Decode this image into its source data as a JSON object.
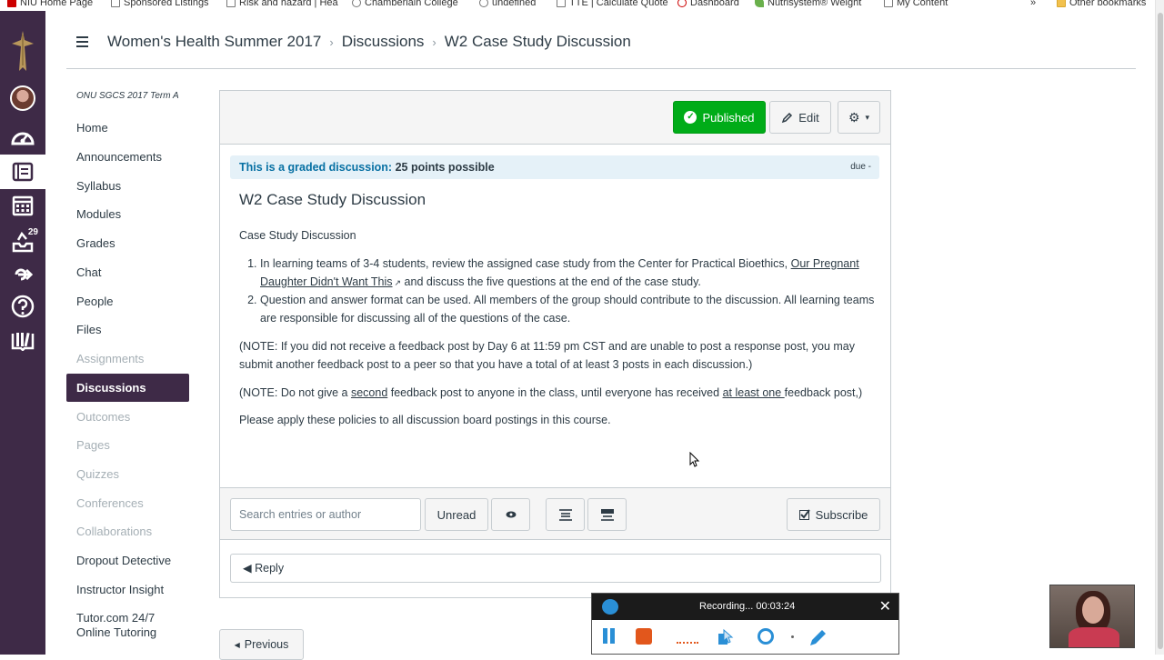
{
  "bookmarks": [
    {
      "label": "NIU Home Page",
      "icon": "niu-icon"
    },
    {
      "label": "Sponsored Listings",
      "icon": "page-icon"
    },
    {
      "label": "Risk and hazard | Hea",
      "icon": "page-icon"
    },
    {
      "label": "Chamberlain College",
      "icon": "shield-icon"
    },
    {
      "label": "undefined",
      "icon": "spiral-icon"
    },
    {
      "label": "TTE | Calculate Quote",
      "icon": "page-icon"
    },
    {
      "label": "Dashboard",
      "icon": "eye-icon"
    },
    {
      "label": "Nutrisystem® Weight",
      "icon": "leaf-icon"
    },
    {
      "label": "My Content",
      "icon": "page-icon"
    }
  ],
  "bookmarks_more": "»",
  "other_bookmarks": "Other bookmarks",
  "global_nav": {
    "items": [
      "logo",
      "account",
      "dashboard",
      "courses",
      "calendar",
      "inbox",
      "commons",
      "help",
      "library"
    ],
    "inbox_badge": "29"
  },
  "breadcrumb": {
    "course": "Women's Health Summer 2017",
    "section": "Discussions",
    "page": "W2 Case Study Discussion",
    "separator": "›"
  },
  "course_nav": {
    "term": "ONU SGCS 2017 Term A",
    "items": [
      {
        "label": "Home",
        "state": "normal"
      },
      {
        "label": "Announcements",
        "state": "normal"
      },
      {
        "label": "Syllabus",
        "state": "normal"
      },
      {
        "label": "Modules",
        "state": "normal"
      },
      {
        "label": "Grades",
        "state": "normal"
      },
      {
        "label": "Chat",
        "state": "normal"
      },
      {
        "label": "People",
        "state": "normal"
      },
      {
        "label": "Files",
        "state": "normal"
      },
      {
        "label": "Assignments",
        "state": "disabled"
      },
      {
        "label": "Discussions",
        "state": "active"
      },
      {
        "label": "Outcomes",
        "state": "disabled"
      },
      {
        "label": "Pages",
        "state": "disabled"
      },
      {
        "label": "Quizzes",
        "state": "disabled"
      },
      {
        "label": "Conferences",
        "state": "disabled"
      },
      {
        "label": "Collaborations",
        "state": "disabled"
      },
      {
        "label": "Dropout Detective",
        "state": "normal"
      },
      {
        "label": "Instructor Insight",
        "state": "normal"
      },
      {
        "label": "Tutor.com 24/7",
        "label2": "Online Tutoring",
        "state": "normal"
      }
    ]
  },
  "toolbar": {
    "published_label": "Published",
    "edit_label": "Edit",
    "gear_caret": "▾"
  },
  "graded": {
    "label": "This is a graded discussion:",
    "points": "25 points possible",
    "due": "due -"
  },
  "discussion": {
    "title": "W2 Case Study Discussion",
    "intro": "Case Study Discussion",
    "item1_a": "In learning teams of 3-4 students, review the assigned case study from the Center for Practical Bioethics, ",
    "item1_link": "Our Pregnant Daughter Didn't Want This",
    "item1_b": " and discuss the five questions at the end of the case study.",
    "item2": "Question and answer format can be used. All members of the group should contribute to the discussion. All learning teams are responsible for discussing all of the questions of the case.",
    "note1": "(NOTE: If you did not receive a feedback post by Day 6 at 11:59 pm CST and are unable to post a response post, you may submit another feedback post to a peer so that you have a total of at least 3 posts in each discussion.)",
    "note2_a": "(NOTE: Do not give a ",
    "note2_u1": "second",
    "note2_b": " feedback post to anyone in the class, until everyone has received ",
    "note2_u2": "at least one ",
    "note2_c": "feedback post,)",
    "closing": "Please apply these policies to all discussion board postings in this course."
  },
  "actions": {
    "search_placeholder": "Search entries or author",
    "unread_label": "Unread",
    "subscribe_label": "Subscribe",
    "reply_label": "Reply"
  },
  "pager": {
    "previous_label": "Previous"
  },
  "recorder": {
    "status": "Recording... 00:03:24",
    "close": "✕"
  },
  "colors": {
    "nav_bg": "#3e2a47",
    "published_green": "#00ac18",
    "link_blue": "#0770a3"
  }
}
